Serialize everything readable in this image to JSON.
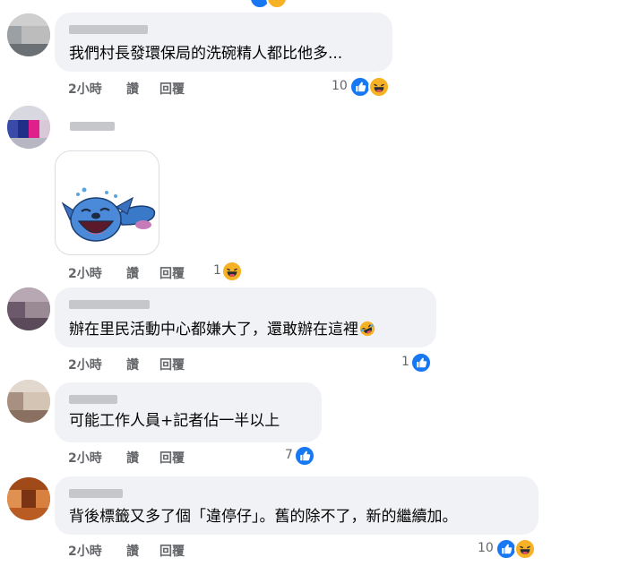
{
  "comments": [
    {
      "text": "我們村長發環保局的洗碗精人都比他多...",
      "time": "2小時",
      "like_label": "讚",
      "reply_label": "回覆",
      "reaction_count": "10",
      "reactions": [
        "like-icon",
        "haha-icon"
      ]
    },
    {
      "sticker": "stitch-laughing-sticker",
      "time": "2小時",
      "like_label": "讚",
      "reply_label": "回覆",
      "reaction_count": "1",
      "reactions": [
        "haha-icon"
      ]
    },
    {
      "text": "辦在里民活動中心都嫌大了，還敢辦在這裡",
      "inline_emoji": "rofl-emoji",
      "time": "2小時",
      "like_label": "讚",
      "reply_label": "回覆",
      "reaction_count": "1",
      "reactions": [
        "like-icon"
      ]
    },
    {
      "text": "可能工作人員+記者佔一半以上",
      "time": "2小時",
      "like_label": "讚",
      "reply_label": "回覆",
      "reaction_count": "7",
      "reactions": [
        "like-icon"
      ]
    },
    {
      "text": "背後標籤又多了個「違停仔」。舊的除不了，新的繼續加。",
      "time": "2小時",
      "like_label": "讚",
      "reply_label": "回覆",
      "reaction_count": "10",
      "reactions": [
        "like-icon",
        "haha-icon"
      ]
    }
  ],
  "colors": {
    "bubble": "#f0f2f5",
    "action_text": "#65676b",
    "like": "#1877f2",
    "haha": "#f7b125"
  }
}
